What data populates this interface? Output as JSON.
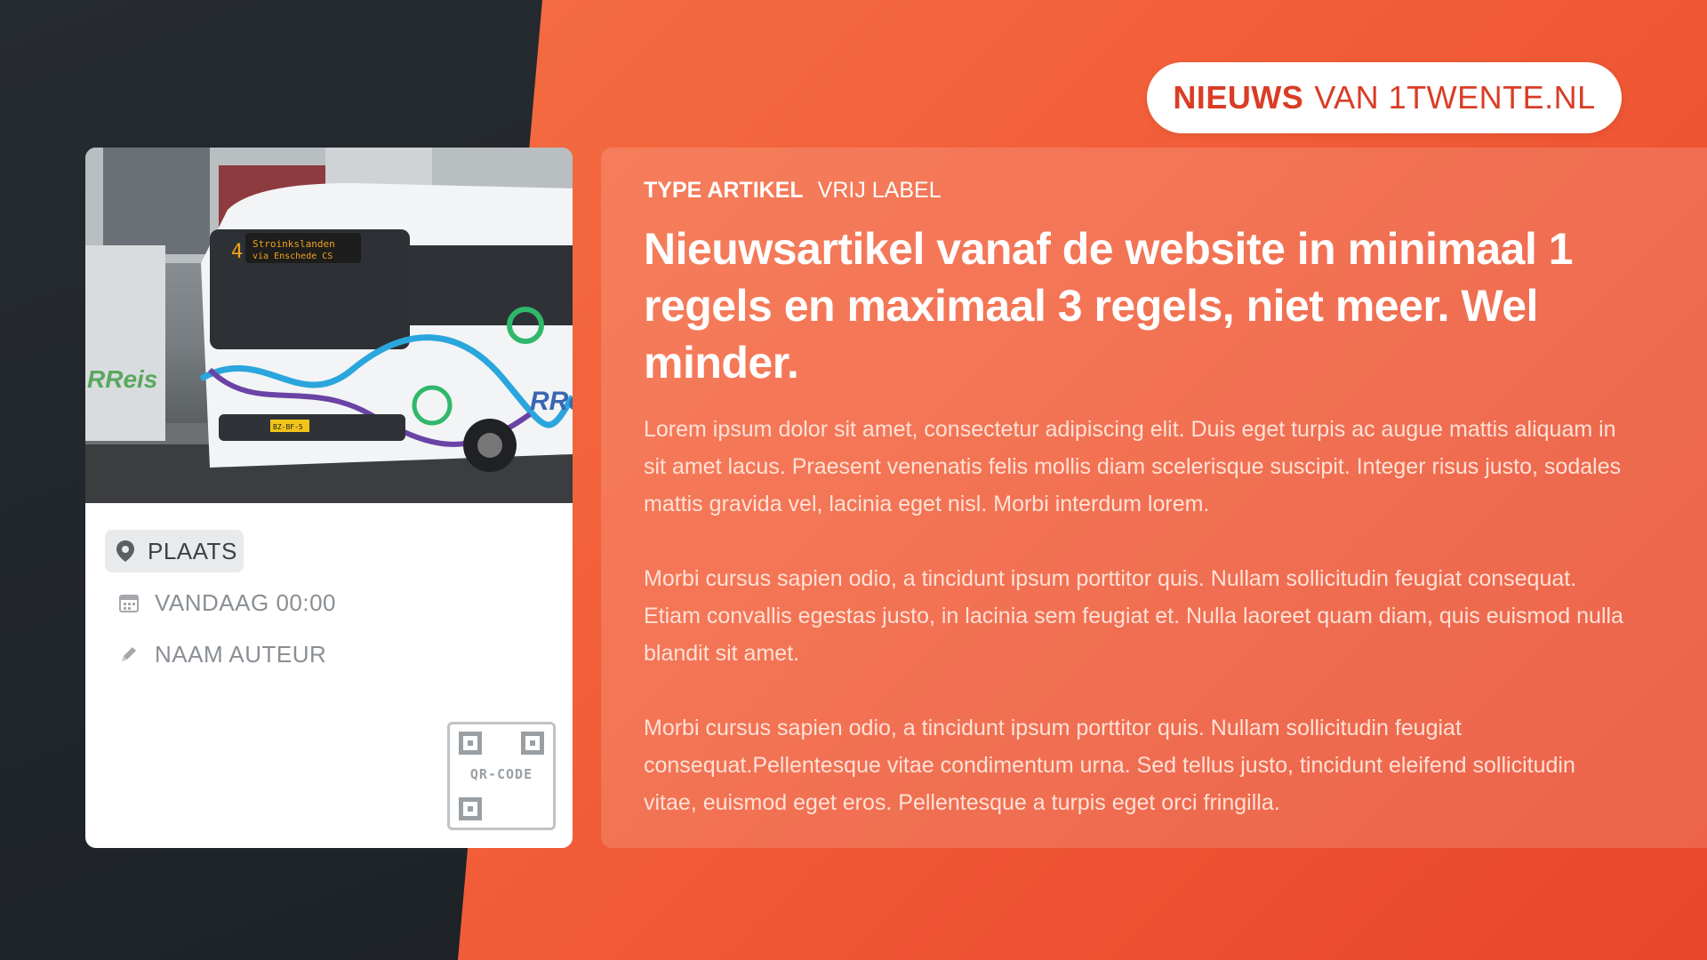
{
  "brand": {
    "strong": "NIEUWS",
    "light": "VAN 1TWENTE.NL"
  },
  "card": {
    "place": "PLAATS",
    "date": "VANDAAG 00:00",
    "author": "NAAM AUTEUR",
    "qr_label": "QR-CODE",
    "photo": {
      "destination_line1": "Stroinkslanden",
      "destination_line2": "via Enschede CS",
      "route_number": "4",
      "brand_text": "RReis",
      "plate": "BZ-BF-5"
    }
  },
  "article": {
    "type_label": "TYPE ARTIKEL",
    "free_label": "VRIJ LABEL",
    "title": "Nieuwsartikel vanaf de website in minimaal 1 regels en maximaal 3 regels, niet meer. Wel minder.",
    "paragraphs": [
      "Lorem ipsum dolor sit amet, consectetur adipiscing elit. Duis eget turpis ac augue mattis aliquam in sit amet lacus. Praesent venenatis felis mollis diam scelerisque suscipit. Integer risus justo, sodales mattis gravida vel, lacinia eget nisl. Morbi interdum lorem.",
      "Morbi cursus sapien odio, a tincidunt ipsum porttitor quis. Nullam sollicitudin feugiat consequat. Etiam convallis egestas justo, in lacinia sem feugiat et. Nulla laoreet quam diam, quis euismod nulla blandit sit amet.",
      "Morbi cursus sapien odio, a tincidunt ipsum porttitor quis. Nullam sollicitudin feugiat consequat.Pellentesque vitae condimentum urna. Sed tellus justo, tincidunt eleifend sollicitudin vitae, euismod eget eros. Pellentesque a turpis eget orci fringilla."
    ]
  },
  "colors": {
    "accent": "#f05a34",
    "dark": "#22272d",
    "brand_text": "#d93d25"
  },
  "icons": {
    "place": "location-pin-icon",
    "date": "calendar-icon",
    "author": "pencil-icon",
    "qr": "qr-code-icon"
  }
}
